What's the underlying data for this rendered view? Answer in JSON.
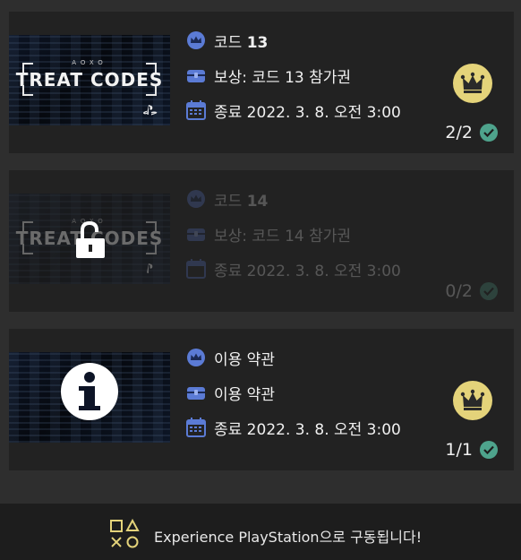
{
  "colors": {
    "page_bg": "#2e2e2e",
    "card_bg": "#222222",
    "icon_blue": "#5b7bd5",
    "crown_gold": "#e4d37a",
    "check_green": "#4ea38c"
  },
  "cards": [
    {
      "thumbnail": {
        "type": "treat-codes",
        "subtitle": "AOXO",
        "title": "TREAT CODES"
      },
      "title_prefix": "코드 ",
      "title_number": "13",
      "reward": "보상: 코드 13 참가권",
      "end": "종료 2022. 3. 8. 오전 3:00",
      "count": "2/2",
      "completed": true,
      "locked": false
    },
    {
      "thumbnail": {
        "type": "treat-codes",
        "subtitle": "AOXO",
        "title": "TREAT CODES"
      },
      "title_prefix": "코드 ",
      "title_number": "14",
      "reward": "보상: 코드 14 참가권",
      "end": "종료 2022. 3. 8. 오전 3:00",
      "count": "0/2",
      "completed": false,
      "locked": true
    },
    {
      "thumbnail": {
        "type": "info"
      },
      "title_prefix": "이용 약관",
      "title_number": "",
      "reward": "이용 약관",
      "end": "종료 2022. 3. 8. 오전 3:00",
      "count": "1/1",
      "completed": true,
      "locked": false
    }
  ],
  "footer": {
    "text": "Experience PlayStation으로 구동됩니다!"
  },
  "icons": {
    "title": "crown-badge-icon",
    "reward": "treasure-chest-icon",
    "end": "calendar-icon",
    "status": "crown-medal-icon",
    "complete": "check-circle-icon",
    "locked": "padlock-icon",
    "footer": "playstation-shapes-icon"
  }
}
